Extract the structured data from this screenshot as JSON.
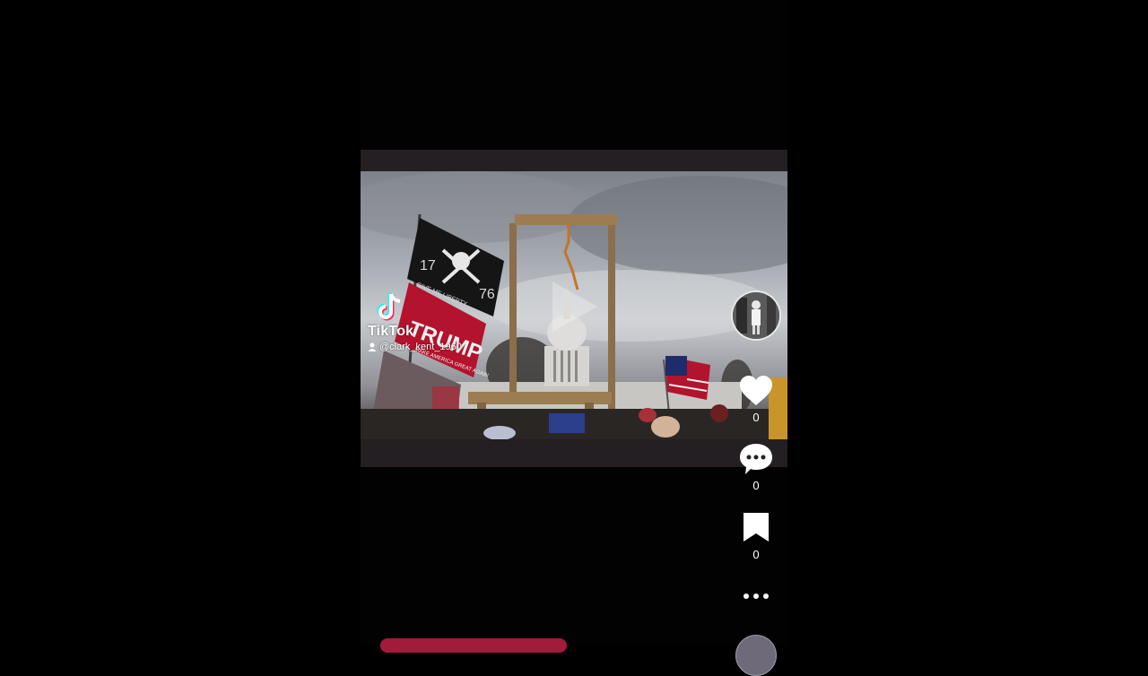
{
  "overlay": {
    "brand": "TikTok",
    "username": "@clark_kent_1960"
  },
  "actions": {
    "likes": "0",
    "comments": "0",
    "bookmarks": "0"
  },
  "video": {
    "flag_text_trump": "TRUMP",
    "flag_text_pirate_year_left": "17",
    "flag_text_pirate_year_right": "76",
    "flag_text_pirate_motto": "GIVE ME LIBERTY",
    "flag_text_maga": "MAKE AMERICA GREAT AGAIN"
  },
  "icons": {
    "play": "play-icon",
    "like": "heart-icon",
    "comment": "comment-icon",
    "bookmark": "bookmark-icon",
    "more": "more-icon"
  },
  "colors": {
    "background": "#000000",
    "letterbox": "#231f22",
    "tiktok_cyan": "#25f4ee",
    "tiktok_red": "#fe2c55",
    "trump_flag": "#b3132c"
  }
}
